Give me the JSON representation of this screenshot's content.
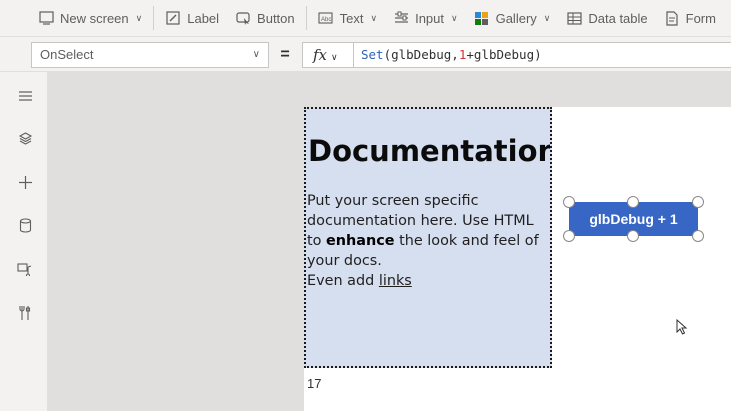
{
  "ribbon": {
    "items": [
      {
        "label": "New screen",
        "icon": "new-screen-icon"
      },
      {
        "label": "Label",
        "icon": "label-icon"
      },
      {
        "label": "Button",
        "icon": "button-icon"
      },
      {
        "label": "Text",
        "icon": "text-icon"
      },
      {
        "label": "Input",
        "icon": "input-icon"
      },
      {
        "label": "Gallery",
        "icon": "gallery-icon"
      },
      {
        "label": "Data table",
        "icon": "data-table-icon"
      },
      {
        "label": "Form",
        "icon": "form-icon"
      }
    ]
  },
  "formula_bar": {
    "property": "OnSelect",
    "equals": "=",
    "fx_label": "fx",
    "formula": {
      "fn": "Set",
      "open": "(glbDebug,",
      "num": "1",
      "rest": "+glbDebug)"
    }
  },
  "left_rail": {
    "icons": [
      "hamburger-menu-icon",
      "layers-icon",
      "plus-icon",
      "database-icon",
      "media-icon",
      "tools-icon"
    ]
  },
  "canvas": {
    "documentation": {
      "title": "Documentation",
      "line1": "Put your screen specific documentation here. Use HTML to",
      "bold": "enhance",
      "line2": " the look and feel of your docs.",
      "line3": "Even add ",
      "link": "links"
    },
    "counter": "17",
    "button_label": "glbDebug + 1"
  },
  "colors": {
    "accent": "#3866c5",
    "doc_bg": "#d6dff0",
    "canvas_bg": "#e1dfdd",
    "formula_fn": "#2b63b7",
    "formula_num": "#d13438"
  }
}
